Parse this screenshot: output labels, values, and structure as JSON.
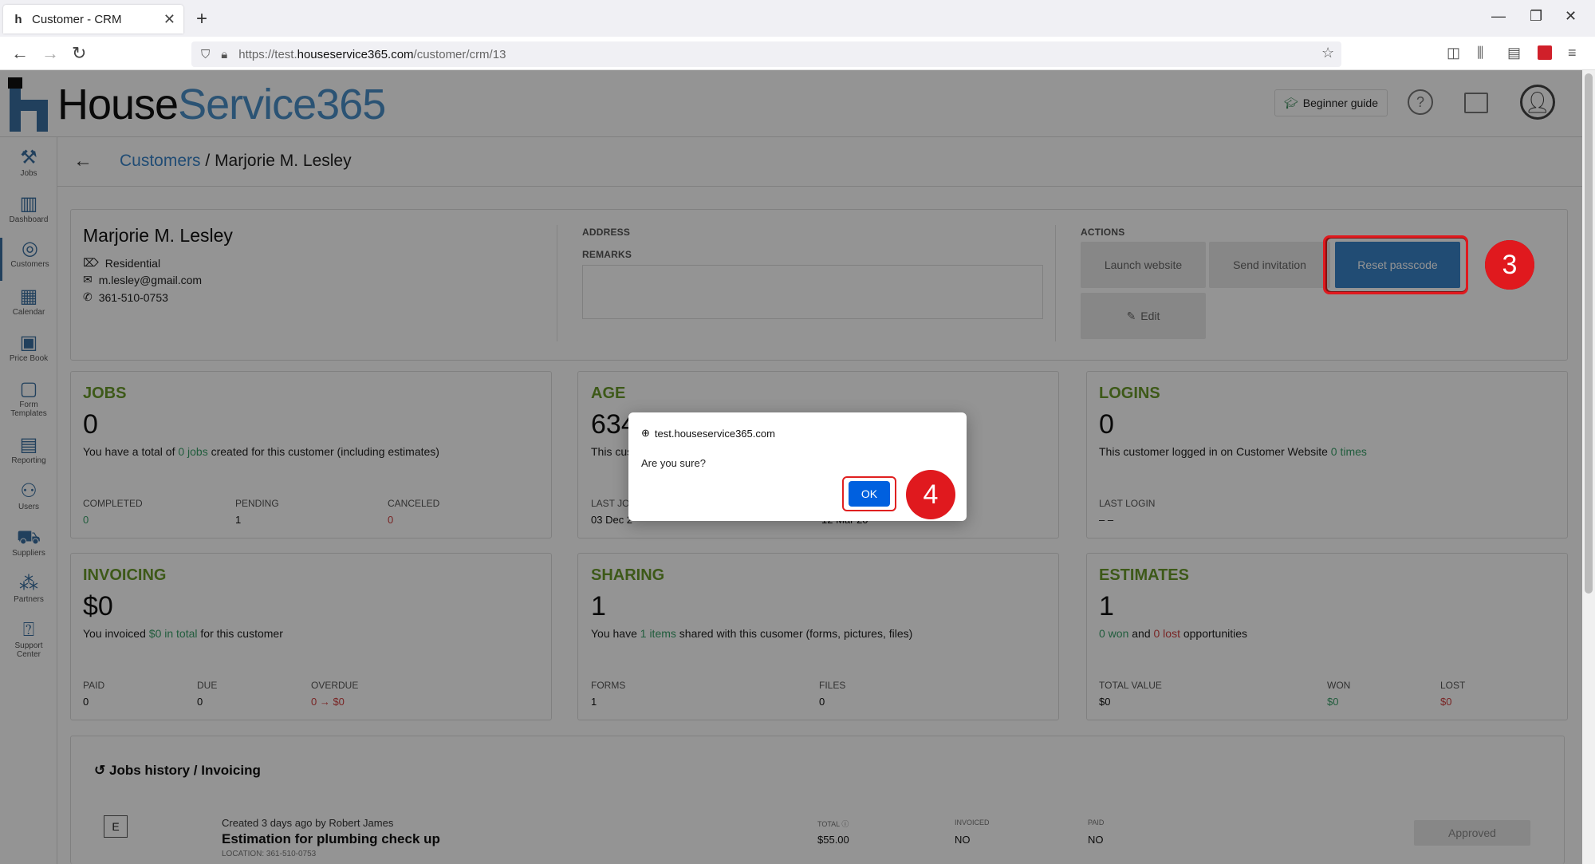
{
  "browser": {
    "tab_title": "Customer - CRM",
    "url_prefix": "https://test.",
    "url_domain": "houseservice365.com",
    "url_path": "/customer/crm/13"
  },
  "app": {
    "logo_house": "House",
    "logo_service": "Service365",
    "beginner_guide": "Beginner guide"
  },
  "sidebar": {
    "items": [
      {
        "label": "Jobs",
        "icon": "tools-icon"
      },
      {
        "label": "Dashboard",
        "icon": "bar-chart-icon"
      },
      {
        "label": "Customers",
        "icon": "target-icon"
      },
      {
        "label": "Calendar",
        "icon": "calendar-icon"
      },
      {
        "label": "Price Book",
        "icon": "price-tag-icon"
      },
      {
        "label": "Form Templates",
        "icon": "form-icon"
      },
      {
        "label": "Reporting",
        "icon": "report-icon"
      },
      {
        "label": "Users",
        "icon": "users-icon"
      },
      {
        "label": "Suppliers",
        "icon": "truck-icon"
      },
      {
        "label": "Partners",
        "icon": "network-icon"
      },
      {
        "label": "Support Center",
        "icon": "help-icon"
      }
    ]
  },
  "breadcrumb": {
    "parent": "Customers",
    "separator": "/",
    "current": "Marjorie M. Lesley"
  },
  "customer": {
    "name": "Marjorie M. Lesley",
    "type": "Residential",
    "email": "m.lesley@gmail.com",
    "phone": "361-510-0753",
    "address_label": "ADDRESS",
    "remarks_label": "REMARKS"
  },
  "actions": {
    "label": "ACTIONS",
    "launch": "Launch website",
    "invite": "Send invitation",
    "reset": "Reset passcode",
    "edit": "Edit"
  },
  "markers": {
    "three": "3",
    "four": "4"
  },
  "jobs": {
    "title": "JOBS",
    "value": "0",
    "desc_pre": "You have a total of ",
    "desc_link": "0 jobs",
    "desc_post": " created for this customer (including estimates)",
    "completed_label": "COMPLETED",
    "completed": "0",
    "pending_label": "PENDING",
    "pending": "1",
    "canceled_label": "CANCELED",
    "canceled": "0"
  },
  "age": {
    "title": "AGE",
    "value": "634",
    "desc": "This cus",
    "last_label": "LAST JO",
    "last": "03 Dec 2",
    "second": "12 Mar 20"
  },
  "logins": {
    "title": "LOGINS",
    "value": "0",
    "desc_pre": "This customer logged in on Customer Website ",
    "desc_link": "0 times",
    "last_label": "LAST LOGIN",
    "last": "– –"
  },
  "invoicing": {
    "title": "INVOICING",
    "value": "$0",
    "desc_pre": "You invoiced ",
    "desc_link": "$0 in total",
    "desc_post": " for this customer",
    "paid_label": "PAID",
    "paid": "0",
    "due_label": "DUE",
    "due": "0",
    "overdue_label": "OVERDUE",
    "overdue": "0 → $0"
  },
  "sharing": {
    "title": "SHARING",
    "value": "1",
    "desc_pre": "You have ",
    "desc_link": "1 items",
    "desc_post": " shared with this cusomer (forms, pictures, files)",
    "forms_label": "FORMS",
    "forms": "1",
    "files_label": "FILES",
    "files": "0"
  },
  "estimates": {
    "title": "ESTIMATES",
    "value": "1",
    "won_link": "0 won",
    "and": " and ",
    "lost_link": "0 lost",
    "post": " opportunities",
    "total_label": "TOTAL VALUE",
    "total": "$0",
    "won_label": "WON",
    "won": "$0",
    "lost_label": "LOST",
    "lost": "$0"
  },
  "history": {
    "title": "Jobs history / Invoicing",
    "badge": "E",
    "created": "Created 3 days ago by Robert James",
    "job_title": "Estimation for plumbing check up",
    "location": "LOCATION: 361-510-0753",
    "total_label": "TOTAL",
    "total": "$55.00",
    "invoiced_label": "INVOICED",
    "invoiced": "NO",
    "paid_label": "PAID",
    "paid": "NO",
    "status": "Approved"
  },
  "dialog": {
    "origin": "test.houseservice365.com",
    "message": "Are you sure?",
    "ok": "OK"
  }
}
